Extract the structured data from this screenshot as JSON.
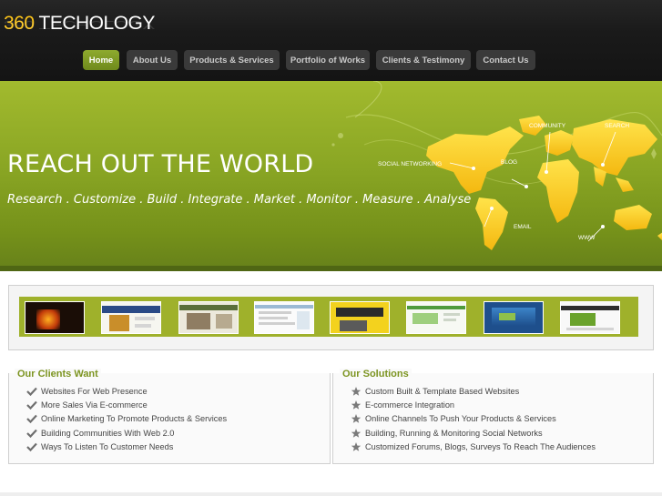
{
  "brand": {
    "number": "360",
    "name": "TECHOLOGY"
  },
  "nav": {
    "items": [
      {
        "label": "Home",
        "active": true
      },
      {
        "label": "About Us",
        "active": false
      },
      {
        "label": "Products & Services",
        "active": false
      },
      {
        "label": "Portfolio of Works",
        "active": false
      },
      {
        "label": "Clients & Testimony",
        "active": false
      },
      {
        "label": "Contact Us",
        "active": false
      }
    ]
  },
  "banner": {
    "headline": "REACH OUT THE WORLD",
    "tagline": "Research . Customize . Build . Integrate . Market . Monitor . Measure . Analyse",
    "map_labels": [
      "COMMUNITY",
      "SEARCH",
      "SOCIAL NETWORKING",
      "BLOG",
      "EMAIL",
      "WWW"
    ]
  },
  "gallery": {
    "thumbnails": [
      "portfolio-thumb-1",
      "portfolio-thumb-2",
      "portfolio-thumb-3",
      "portfolio-thumb-4",
      "portfolio-thumb-5",
      "portfolio-thumb-6",
      "portfolio-thumb-7",
      "portfolio-thumb-8"
    ]
  },
  "clients": {
    "title": "Our Clients Want",
    "icon": "checkmark-icon",
    "items": [
      "Websites For Web Presence",
      "More Sales Via E-commerce",
      "Online Marketing To Promote Products & Services",
      "Building Communities With Web 2.0",
      "Ways To Listen To Customer Needs"
    ]
  },
  "solutions": {
    "title": "Our Solutions",
    "icon": "star-icon",
    "items": [
      "Custom Built & Template Based Websites",
      "E-commerce Integration",
      "Online Channels To Push Your Products & Services",
      "Building, Running & Monitoring Social Networks",
      "Customized Forums, Blogs, Surveys To Reach The Audiences"
    ]
  },
  "colors": {
    "accent": "#7c9420",
    "banner": "#8aa624",
    "map": "#ffd21a"
  }
}
